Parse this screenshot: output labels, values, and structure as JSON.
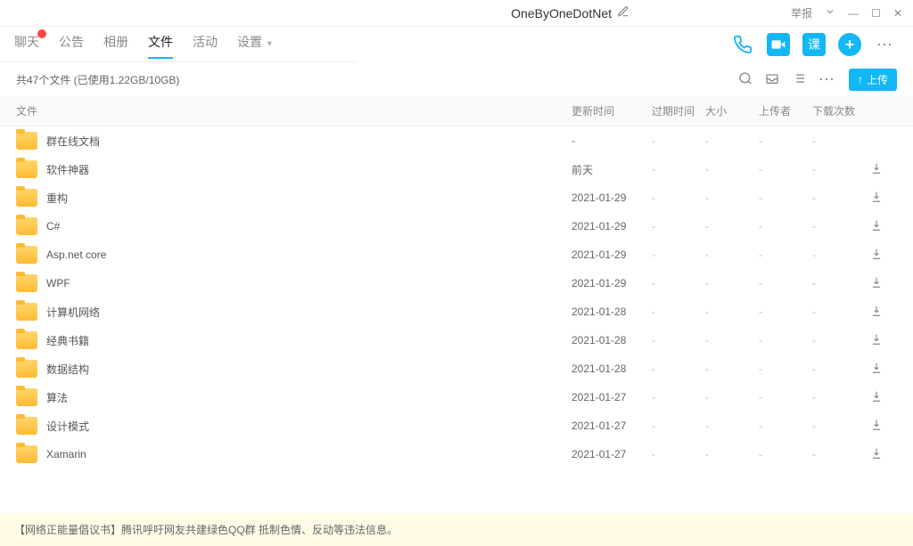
{
  "titlebar": {
    "title": "OneByOneDotNet",
    "report": "举报"
  },
  "tabs": {
    "chat": "聊天",
    "notice": "公告",
    "album": "相册",
    "files": "文件",
    "activity": "活动",
    "settings": "设置"
  },
  "subbar": {
    "summary": "共47个文件 (已使用1.22GB/10GB)",
    "upload": "上传"
  },
  "headers": {
    "file": "文件",
    "update": "更新时间",
    "expire": "过期时间",
    "size": "大小",
    "uploader": "上传者",
    "downloads": "下载次数"
  },
  "files": [
    {
      "name": "群在线文档",
      "update": "-",
      "expire": "-",
      "size": "-",
      "uploader": "-",
      "downloads": "-",
      "dl": false
    },
    {
      "name": "软件神器",
      "update": "前天",
      "expire": "-",
      "size": "-",
      "uploader": "-",
      "downloads": "-",
      "dl": true
    },
    {
      "name": "重构",
      "update": "2021-01-29",
      "expire": "-",
      "size": "-",
      "uploader": "-",
      "downloads": "-",
      "dl": true
    },
    {
      "name": "C#",
      "update": "2021-01-29",
      "expire": "-",
      "size": "-",
      "uploader": "-",
      "downloads": "-",
      "dl": true
    },
    {
      "name": "Asp.net core",
      "update": "2021-01-29",
      "expire": "-",
      "size": "-",
      "uploader": "-",
      "downloads": "-",
      "dl": true
    },
    {
      "name": "WPF",
      "update": "2021-01-29",
      "expire": "-",
      "size": "-",
      "uploader": "-",
      "downloads": "-",
      "dl": true
    },
    {
      "name": "计算机网络",
      "update": "2021-01-28",
      "expire": "-",
      "size": "-",
      "uploader": "-",
      "downloads": "-",
      "dl": true
    },
    {
      "name": "经典书籍",
      "update": "2021-01-28",
      "expire": "-",
      "size": "-",
      "uploader": "-",
      "downloads": "-",
      "dl": true
    },
    {
      "name": "数据结构",
      "update": "2021-01-28",
      "expire": "-",
      "size": "-",
      "uploader": "-",
      "downloads": "-",
      "dl": true
    },
    {
      "name": "算法",
      "update": "2021-01-27",
      "expire": "-",
      "size": "-",
      "uploader": "-",
      "downloads": "-",
      "dl": true
    },
    {
      "name": "设计模式",
      "update": "2021-01-27",
      "expire": "-",
      "size": "-",
      "uploader": "-",
      "downloads": "-",
      "dl": true
    },
    {
      "name": "Xamarin",
      "update": "2021-01-27",
      "expire": "-",
      "size": "-",
      "uploader": "-",
      "downloads": "-",
      "dl": true
    }
  ],
  "footer": "【网络正能量倡议书】腾讯呼吁网友共建绿色QQ群 抵制色情、反动等违法信息。",
  "icons": {
    "class": "课",
    "plus": "+",
    "more": "⋯",
    "uparrow": "↑"
  }
}
